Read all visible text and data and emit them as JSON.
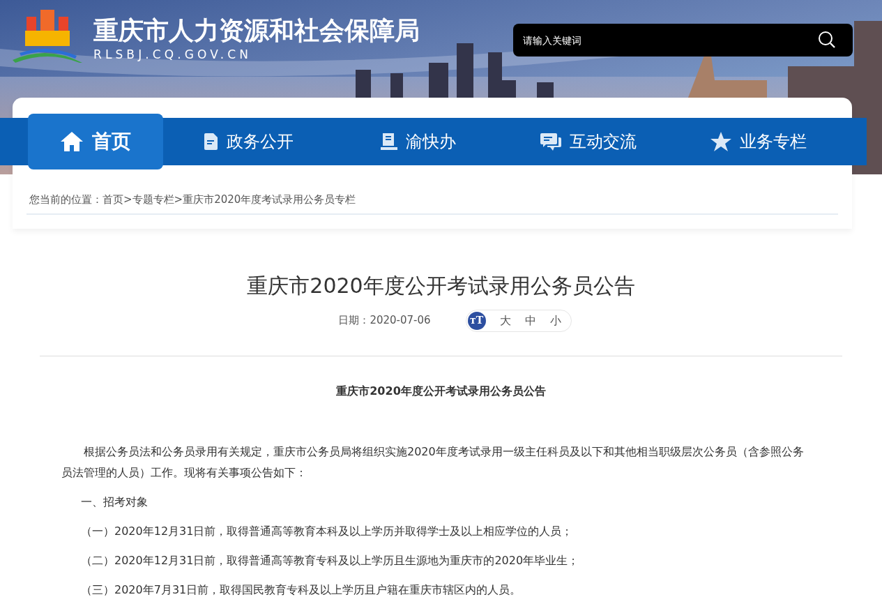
{
  "site": {
    "title": "重庆市人力资源和社会保障局",
    "domain": "RLSBJ.CQ.GOV.CN"
  },
  "search": {
    "placeholder": "请输入关键词"
  },
  "nav": [
    {
      "kind": "home",
      "label": "首页",
      "selected": true
    },
    {
      "kind": "doc",
      "label": "政务公开",
      "selected": false
    },
    {
      "kind": "book",
      "label": "渝快办",
      "selected": false
    },
    {
      "kind": "chat",
      "label": "互动交流",
      "selected": false
    },
    {
      "kind": "star",
      "label": "业务专栏",
      "selected": false
    }
  ],
  "breadcrumb": {
    "label": "您当前的位置：",
    "items": [
      "首页",
      ">",
      "专题专栏",
      ">",
      "重庆市2020年度考试录用公务员专栏"
    ]
  },
  "article": {
    "title": "重庆市2020年度公开考试录用公务员公告",
    "date": "日期：2020-07-06",
    "font_size": {
      "icon": "тT",
      "options": [
        "大",
        "中",
        "小"
      ]
    },
    "subtitle": "重庆市2020年度公开考试录用公务员公告",
    "body": [
      {
        "kind": "para",
        "text": "根据公务员法和公务员录用有关规定，重庆市公务员局将组织实施2020年度考试录用一级主任科员及以下和其他相当职级层次公务员（含参照公务员法管理的人员）工作。现将有关事项公告如下："
      },
      {
        "kind": "heading",
        "text": "一、招考对象"
      },
      {
        "kind": "item",
        "text": "（一）2020年12月31日前，取得普通高等教育本科及以上学历并取得学士及以上相应学位的人员；"
      },
      {
        "kind": "item",
        "text": "（二）2020年12月31日前，取得普通高等教育专科及以上学历且生源地为重庆市的2020年毕业生；"
      },
      {
        "kind": "item",
        "text": "（三）2020年7月31日前，取得国民教育专科及以上学历且户籍在重庆市辖区内的人员。"
      }
    ]
  }
}
